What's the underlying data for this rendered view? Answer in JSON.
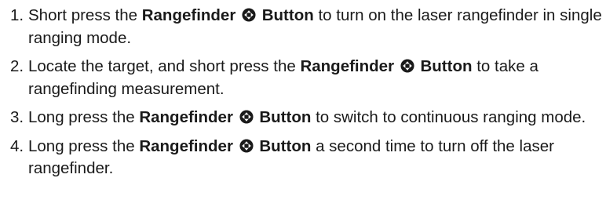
{
  "icon": "rangefinder-button-icon",
  "steps": [
    {
      "number": "1.",
      "before": "Short press the",
      "label": "Rangefinder",
      "button": "Button",
      "after": "to turn on the laser rangefinder in single ranging mode."
    },
    {
      "number": "2.",
      "before": "Locate the target, and short press the",
      "label": "Rangefinder",
      "button": "Button",
      "after": "to take a rangefinding measurement."
    },
    {
      "number": "3.",
      "before": "Long press the",
      "label": "Rangefinder",
      "button": "Button",
      "after": "to switch to continuous ranging mode."
    },
    {
      "number": "4.",
      "before": "Long press the",
      "label": "Rangefinder",
      "button": "Button",
      "after": "a second time to turn off the laser rangefinder."
    }
  ]
}
